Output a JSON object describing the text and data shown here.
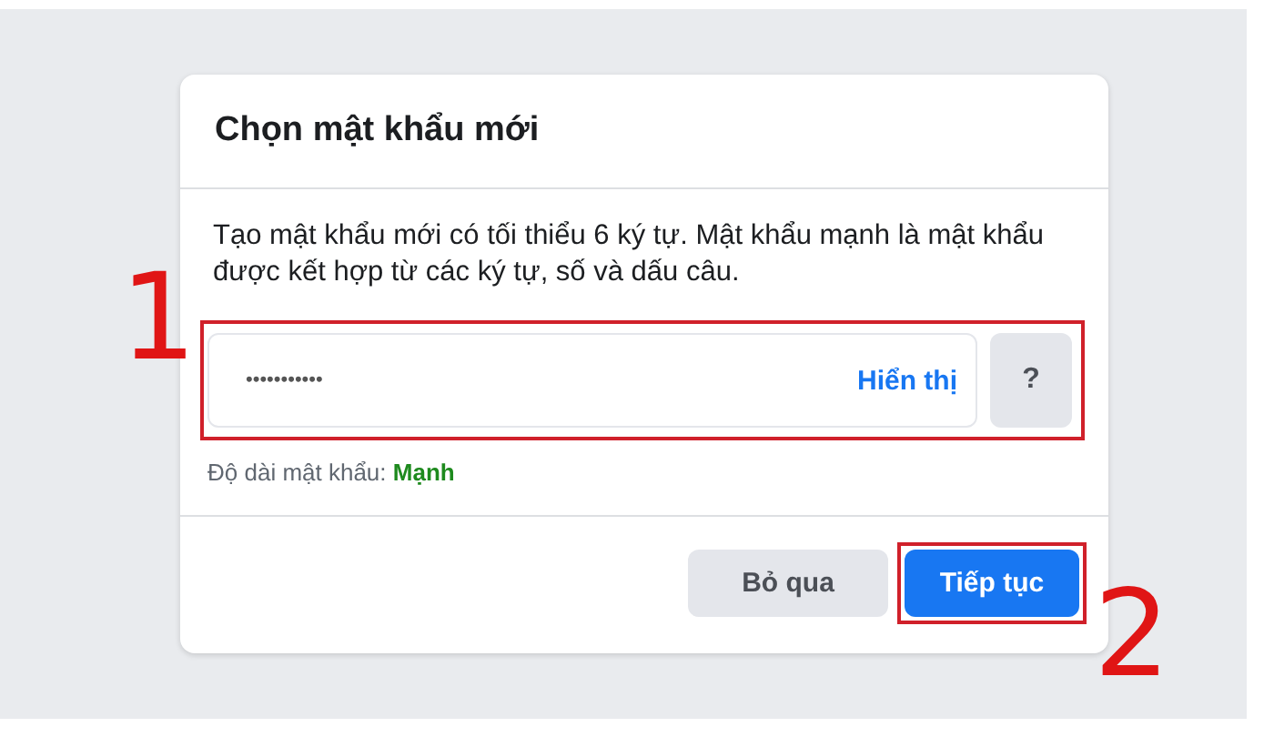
{
  "dialog": {
    "title": "Chọn mật khẩu mới",
    "description": "Tạo mật khẩu mới có tối thiểu 6 ký tự. Mật khẩu mạnh là mật khẩu được kết hợp từ các ký tự, số và dấu câu.",
    "password_field": {
      "value": "•••••••••••",
      "show_link": "Hiển thị",
      "help_button": "?"
    },
    "strength_label": "Độ dài mật khẩu:",
    "strength_value": "Mạnh",
    "buttons": [
      {
        "label": "Bỏ qua",
        "kind": "secondary"
      },
      {
        "label": "Tiếp tục",
        "kind": "primary"
      }
    ]
  },
  "annotations": [
    {
      "label": "1"
    },
    {
      "label": "2"
    }
  ]
}
